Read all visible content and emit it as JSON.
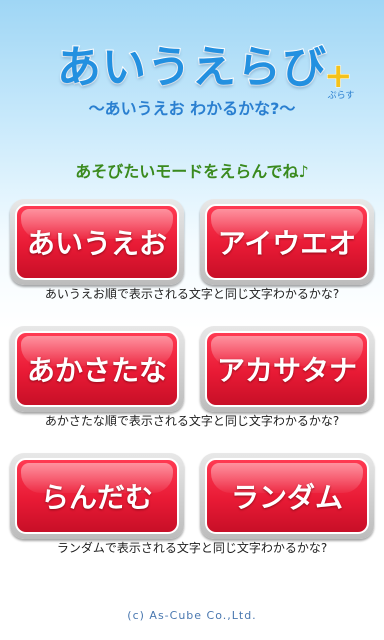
{
  "logo": {
    "title": "あいうえらび",
    "plus_symbol": "+",
    "plus_label": "ぷらす"
  },
  "subtitle": "〜あいうえお わかるかな?〜",
  "prompt": "あそびたいモードをえらんでね♪",
  "modes": [
    {
      "buttons": [
        "あいうえお",
        "アイウエオ"
      ],
      "description": "あいうえお順で表示される文字と同じ文字わかるかな?"
    },
    {
      "buttons": [
        "あかさたな",
        "アカサタナ"
      ],
      "description": "あかさたな順で表示される文字と同じ文字わかるかな?"
    },
    {
      "buttons": [
        "らんだむ",
        "ランダム"
      ],
      "description": "ランダムで表示される文字と同じ文字わかるかな?"
    }
  ],
  "footer": {
    "copyright": "(c) As-Cube Co.,Ltd."
  },
  "colors": {
    "title_blue": "#2390e0",
    "button_red": "#e81a35",
    "prompt_green": "#3a8a1e",
    "plus_yellow": "#f4c21b"
  }
}
